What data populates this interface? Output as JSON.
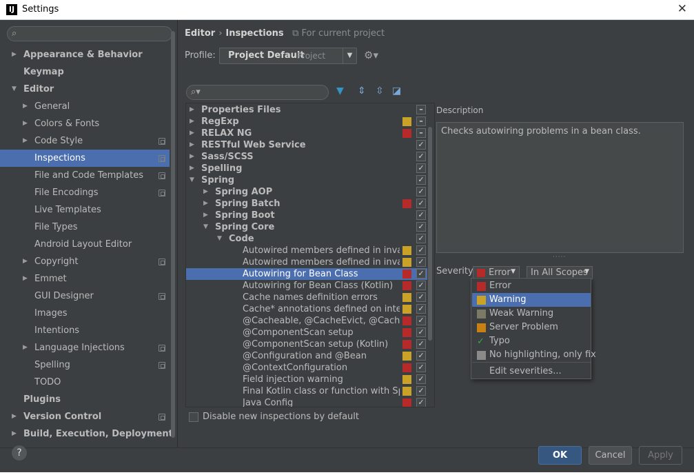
{
  "window": {
    "title": "Settings",
    "app_icon": "IJ"
  },
  "sidebar": {
    "search_placeholder": "",
    "items": [
      {
        "label": "Appearance & Behavior",
        "level": 0,
        "bold": true,
        "arrow": "right",
        "proj": false
      },
      {
        "label": "Keymap",
        "level": 0,
        "bold": true,
        "arrow": "",
        "proj": false
      },
      {
        "label": "Editor",
        "level": 0,
        "bold": true,
        "arrow": "down",
        "proj": false
      },
      {
        "label": "General",
        "level": 1,
        "bold": false,
        "arrow": "right",
        "proj": false
      },
      {
        "label": "Colors & Fonts",
        "level": 1,
        "bold": false,
        "arrow": "right",
        "proj": false
      },
      {
        "label": "Code Style",
        "level": 1,
        "bold": false,
        "arrow": "right",
        "proj": true
      },
      {
        "label": "Inspections",
        "level": 1,
        "bold": false,
        "arrow": "",
        "proj": true,
        "selected": true
      },
      {
        "label": "File and Code Templates",
        "level": 1,
        "bold": false,
        "arrow": "",
        "proj": true
      },
      {
        "label": "File Encodings",
        "level": 1,
        "bold": false,
        "arrow": "",
        "proj": true
      },
      {
        "label": "Live Templates",
        "level": 1,
        "bold": false,
        "arrow": "",
        "proj": false
      },
      {
        "label": "File Types",
        "level": 1,
        "bold": false,
        "arrow": "",
        "proj": false
      },
      {
        "label": "Android Layout Editor",
        "level": 1,
        "bold": false,
        "arrow": "",
        "proj": false
      },
      {
        "label": "Copyright",
        "level": 1,
        "bold": false,
        "arrow": "right",
        "proj": true
      },
      {
        "label": "Emmet",
        "level": 1,
        "bold": false,
        "arrow": "right",
        "proj": false
      },
      {
        "label": "GUI Designer",
        "level": 1,
        "bold": false,
        "arrow": "",
        "proj": true
      },
      {
        "label": "Images",
        "level": 1,
        "bold": false,
        "arrow": "",
        "proj": false
      },
      {
        "label": "Intentions",
        "level": 1,
        "bold": false,
        "arrow": "",
        "proj": false
      },
      {
        "label": "Language Injections",
        "level": 1,
        "bold": false,
        "arrow": "right",
        "proj": true
      },
      {
        "label": "Spelling",
        "level": 1,
        "bold": false,
        "arrow": "",
        "proj": true
      },
      {
        "label": "TODO",
        "level": 1,
        "bold": false,
        "arrow": "",
        "proj": false
      },
      {
        "label": "Plugins",
        "level": 0,
        "bold": true,
        "arrow": "",
        "proj": false
      },
      {
        "label": "Version Control",
        "level": 0,
        "bold": true,
        "arrow": "right",
        "proj": true
      },
      {
        "label": "Build, Execution, Deployment",
        "level": 0,
        "bold": true,
        "arrow": "right",
        "proj": false
      }
    ]
  },
  "breadcrumb": {
    "part1": "Editor",
    "separator": "›",
    "part2": "Inspections",
    "scope_note": "For current project"
  },
  "profile": {
    "label": "Profile:",
    "value": "Project Default",
    "type": "Project"
  },
  "inspections": [
    {
      "label": "Properties Files",
      "level": 0,
      "bold": true,
      "arrow": "right",
      "sev": "",
      "check": "minus"
    },
    {
      "label": "RegExp",
      "level": 0,
      "bold": true,
      "arrow": "right",
      "sev": "#c9a227",
      "check": "minus"
    },
    {
      "label": "RELAX NG",
      "level": 0,
      "bold": true,
      "arrow": "right",
      "sev": "#b72a2a",
      "check": "minus"
    },
    {
      "label": "RESTful Web Service",
      "level": 0,
      "bold": true,
      "arrow": "right",
      "sev": "",
      "check": "check"
    },
    {
      "label": "Sass/SCSS",
      "level": 0,
      "bold": true,
      "arrow": "right",
      "sev": "",
      "check": "check"
    },
    {
      "label": "Spelling",
      "level": 0,
      "bold": true,
      "arrow": "right",
      "sev": "",
      "check": "check"
    },
    {
      "label": "Spring",
      "level": 0,
      "bold": true,
      "arrow": "down",
      "sev": "",
      "check": "check"
    },
    {
      "label": "Spring AOP",
      "level": 1,
      "bold": true,
      "arrow": "right",
      "sev": "",
      "check": "check"
    },
    {
      "label": "Spring Batch",
      "level": 1,
      "bold": true,
      "arrow": "right",
      "sev": "#b72a2a",
      "check": "check"
    },
    {
      "label": "Spring Boot",
      "level": 1,
      "bold": true,
      "arrow": "right",
      "sev": "",
      "check": "check"
    },
    {
      "label": "Spring Core",
      "level": 1,
      "bold": true,
      "arrow": "down",
      "sev": "",
      "check": "check"
    },
    {
      "label": "Code",
      "level": 2,
      "bold": true,
      "arrow": "down",
      "sev": "",
      "check": "check"
    },
    {
      "label": "Autowired members defined in invalid Spring bean",
      "level": 3,
      "bold": false,
      "arrow": "",
      "sev": "#c9a227",
      "check": "check"
    },
    {
      "label": "Autowired members defined in invalid Spring bean",
      "level": 3,
      "bold": false,
      "arrow": "",
      "sev": "#c9a227",
      "check": "check"
    },
    {
      "label": "Autowiring for Bean Class",
      "level": 3,
      "bold": false,
      "arrow": "",
      "sev": "#b72a2a",
      "check": "check",
      "selected": true
    },
    {
      "label": "Autowiring for Bean Class (Kotlin)",
      "level": 3,
      "bold": false,
      "arrow": "",
      "sev": "#b72a2a",
      "check": "check"
    },
    {
      "label": "Cache names definition errors",
      "level": 3,
      "bold": false,
      "arrow": "",
      "sev": "#c9a227",
      "check": "check"
    },
    {
      "label": "Cache* annotations defined on interface/interface method",
      "level": 3,
      "bold": false,
      "arrow": "",
      "sev": "#c9a227",
      "check": "check"
    },
    {
      "label": "@Cacheable, @CacheEvict, @CachePut, @CacheConfig",
      "level": 3,
      "bold": false,
      "arrow": "",
      "sev": "#b72a2a",
      "check": "check"
    },
    {
      "label": "@ComponentScan setup",
      "level": 3,
      "bold": false,
      "arrow": "",
      "sev": "#b72a2a",
      "check": "check"
    },
    {
      "label": "@ComponentScan setup (Kotlin)",
      "level": 3,
      "bold": false,
      "arrow": "",
      "sev": "#b72a2a",
      "check": "check"
    },
    {
      "label": "@Configuration and @Bean",
      "level": 3,
      "bold": false,
      "arrow": "",
      "sev": "#c9a227",
      "check": "check"
    },
    {
      "label": "@ContextConfiguration",
      "level": 3,
      "bold": false,
      "arrow": "",
      "sev": "#b72a2a",
      "check": "check"
    },
    {
      "label": "Field injection warning",
      "level": 3,
      "bold": false,
      "arrow": "",
      "sev": "#c9a227",
      "check": "check"
    },
    {
      "label": "Final Kotlin class or function with Spring annotation",
      "level": 3,
      "bold": false,
      "arrow": "",
      "sev": "#c9a227",
      "check": "check"
    },
    {
      "label": "Java Config",
      "level": 3,
      "bold": false,
      "arrow": "",
      "sev": "#b72a2a",
      "check": "check"
    }
  ],
  "disable_new": {
    "label": "Disable new inspections by default",
    "checked": false
  },
  "description": {
    "label": "Description",
    "text": "Checks autowiring problems in a bean class."
  },
  "severity": {
    "label": "Severity:",
    "value": "Error",
    "color": "#b72a2a"
  },
  "scope": {
    "value": "In All Scopes"
  },
  "severity_options": [
    {
      "label": "Error",
      "color": "#b72a2a",
      "selected": false
    },
    {
      "label": "Warning",
      "color": "#c9a227",
      "selected": true
    },
    {
      "label": "Weak Warning",
      "color": "#7c7a64",
      "selected": false
    },
    {
      "label": "Server Problem",
      "color": "#c98013",
      "selected": false
    },
    {
      "label": "Typo",
      "color": "typo-check",
      "selected": false
    },
    {
      "label": "No highlighting, only fix",
      "color": "#8a8a8a",
      "selected": false
    }
  ],
  "edit_severities": "Edit severities...",
  "buttons": {
    "ok": "OK",
    "cancel": "Cancel",
    "apply": "Apply",
    "help": "?"
  },
  "colors": {
    "selection": "#4b6eaf",
    "error": "#b72a2a",
    "warning": "#c9a227",
    "background": "#3c3f41"
  }
}
